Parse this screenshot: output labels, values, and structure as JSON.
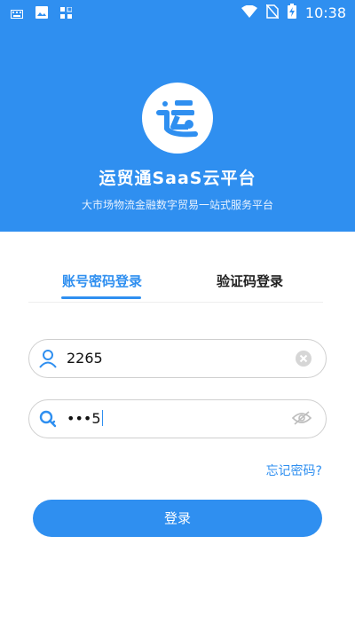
{
  "status_bar": {
    "time": "10:38",
    "left_icons": [
      "keyboard-icon",
      "image-icon",
      "grid-icon"
    ],
    "right_icons": [
      "wifi-icon",
      "no-sim-icon",
      "battery-charging-icon"
    ]
  },
  "header": {
    "logo_char": "运",
    "title": "运贸通SaaS云平台",
    "subtitle": "大市场物流金融数字贸易一站式服务平台",
    "background_color": "#2f8ff0"
  },
  "tabs": [
    {
      "label": "账号密码登录",
      "active": true
    },
    {
      "label": "验证码登录",
      "active": false
    }
  ],
  "username": {
    "value": "2265",
    "icon": "user-icon",
    "clear_icon": "clear-icon"
  },
  "password": {
    "masked": "•••",
    "last_char": "5",
    "icon": "key-icon",
    "toggle_icon": "eye-hidden-icon"
  },
  "forgot_password": "忘记密码?",
  "login_button": "登录",
  "accent_color": "#2f8ff0"
}
